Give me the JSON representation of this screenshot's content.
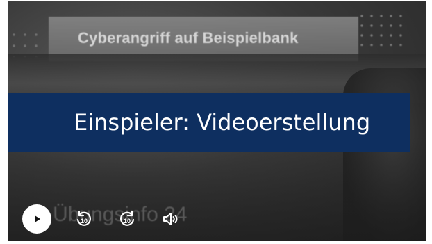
{
  "video": {
    "background_sign_text": "Cyberangriff auf Beispielbank",
    "background_ghost_text": "Übungsinfo 24",
    "title": "Einspieler: Videoerstellung",
    "banner_color": "#0e2f60"
  },
  "controls": {
    "play": {
      "icon": "play-icon"
    },
    "rewind": {
      "icon": "rewind-10-icon",
      "seconds": "10"
    },
    "forward": {
      "icon": "forward-10-icon",
      "seconds": "10"
    },
    "volume": {
      "icon": "volume-icon"
    }
  }
}
